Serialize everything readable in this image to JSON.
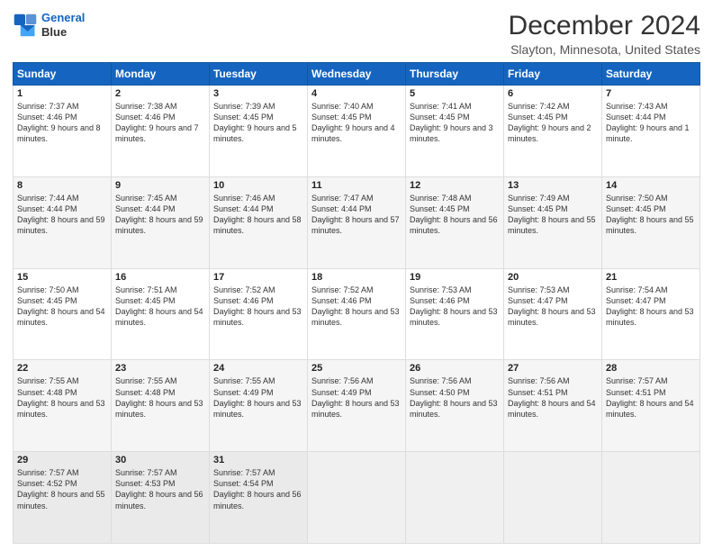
{
  "header": {
    "logo_line1": "General",
    "logo_line2": "Blue",
    "title": "December 2024",
    "subtitle": "Slayton, Minnesota, United States"
  },
  "weekdays": [
    "Sunday",
    "Monday",
    "Tuesday",
    "Wednesday",
    "Thursday",
    "Friday",
    "Saturday"
  ],
  "weeks": [
    [
      {
        "day": "1",
        "rise": "7:37 AM",
        "set": "4:46 PM",
        "daylight": "9 hours and 8 minutes."
      },
      {
        "day": "2",
        "rise": "7:38 AM",
        "set": "4:46 PM",
        "daylight": "9 hours and 7 minutes."
      },
      {
        "day": "3",
        "rise": "7:39 AM",
        "set": "4:45 PM",
        "daylight": "9 hours and 5 minutes."
      },
      {
        "day": "4",
        "rise": "7:40 AM",
        "set": "4:45 PM",
        "daylight": "9 hours and 4 minutes."
      },
      {
        "day": "5",
        "rise": "7:41 AM",
        "set": "4:45 PM",
        "daylight": "9 hours and 3 minutes."
      },
      {
        "day": "6",
        "rise": "7:42 AM",
        "set": "4:45 PM",
        "daylight": "9 hours and 2 minutes."
      },
      {
        "day": "7",
        "rise": "7:43 AM",
        "set": "4:44 PM",
        "daylight": "9 hours and 1 minute."
      }
    ],
    [
      {
        "day": "8",
        "rise": "7:44 AM",
        "set": "4:44 PM",
        "daylight": "8 hours and 59 minutes."
      },
      {
        "day": "9",
        "rise": "7:45 AM",
        "set": "4:44 PM",
        "daylight": "8 hours and 59 minutes."
      },
      {
        "day": "10",
        "rise": "7:46 AM",
        "set": "4:44 PM",
        "daylight": "8 hours and 58 minutes."
      },
      {
        "day": "11",
        "rise": "7:47 AM",
        "set": "4:44 PM",
        "daylight": "8 hours and 57 minutes."
      },
      {
        "day": "12",
        "rise": "7:48 AM",
        "set": "4:45 PM",
        "daylight": "8 hours and 56 minutes."
      },
      {
        "day": "13",
        "rise": "7:49 AM",
        "set": "4:45 PM",
        "daylight": "8 hours and 55 minutes."
      },
      {
        "day": "14",
        "rise": "7:50 AM",
        "set": "4:45 PM",
        "daylight": "8 hours and 55 minutes."
      }
    ],
    [
      {
        "day": "15",
        "rise": "7:50 AM",
        "set": "4:45 PM",
        "daylight": "8 hours and 54 minutes."
      },
      {
        "day": "16",
        "rise": "7:51 AM",
        "set": "4:45 PM",
        "daylight": "8 hours and 54 minutes."
      },
      {
        "day": "17",
        "rise": "7:52 AM",
        "set": "4:46 PM",
        "daylight": "8 hours and 53 minutes."
      },
      {
        "day": "18",
        "rise": "7:52 AM",
        "set": "4:46 PM",
        "daylight": "8 hours and 53 minutes."
      },
      {
        "day": "19",
        "rise": "7:53 AM",
        "set": "4:46 PM",
        "daylight": "8 hours and 53 minutes."
      },
      {
        "day": "20",
        "rise": "7:53 AM",
        "set": "4:47 PM",
        "daylight": "8 hours and 53 minutes."
      },
      {
        "day": "21",
        "rise": "7:54 AM",
        "set": "4:47 PM",
        "daylight": "8 hours and 53 minutes."
      }
    ],
    [
      {
        "day": "22",
        "rise": "7:55 AM",
        "set": "4:48 PM",
        "daylight": "8 hours and 53 minutes."
      },
      {
        "day": "23",
        "rise": "7:55 AM",
        "set": "4:48 PM",
        "daylight": "8 hours and 53 minutes."
      },
      {
        "day": "24",
        "rise": "7:55 AM",
        "set": "4:49 PM",
        "daylight": "8 hours and 53 minutes."
      },
      {
        "day": "25",
        "rise": "7:56 AM",
        "set": "4:49 PM",
        "daylight": "8 hours and 53 minutes."
      },
      {
        "day": "26",
        "rise": "7:56 AM",
        "set": "4:50 PM",
        "daylight": "8 hours and 53 minutes."
      },
      {
        "day": "27",
        "rise": "7:56 AM",
        "set": "4:51 PM",
        "daylight": "8 hours and 54 minutes."
      },
      {
        "day": "28",
        "rise": "7:57 AM",
        "set": "4:51 PM",
        "daylight": "8 hours and 54 minutes."
      }
    ],
    [
      {
        "day": "29",
        "rise": "7:57 AM",
        "set": "4:52 PM",
        "daylight": "8 hours and 55 minutes."
      },
      {
        "day": "30",
        "rise": "7:57 AM",
        "set": "4:53 PM",
        "daylight": "8 hours and 56 minutes."
      },
      {
        "day": "31",
        "rise": "7:57 AM",
        "set": "4:54 PM",
        "daylight": "8 hours and 56 minutes."
      },
      null,
      null,
      null,
      null
    ]
  ]
}
